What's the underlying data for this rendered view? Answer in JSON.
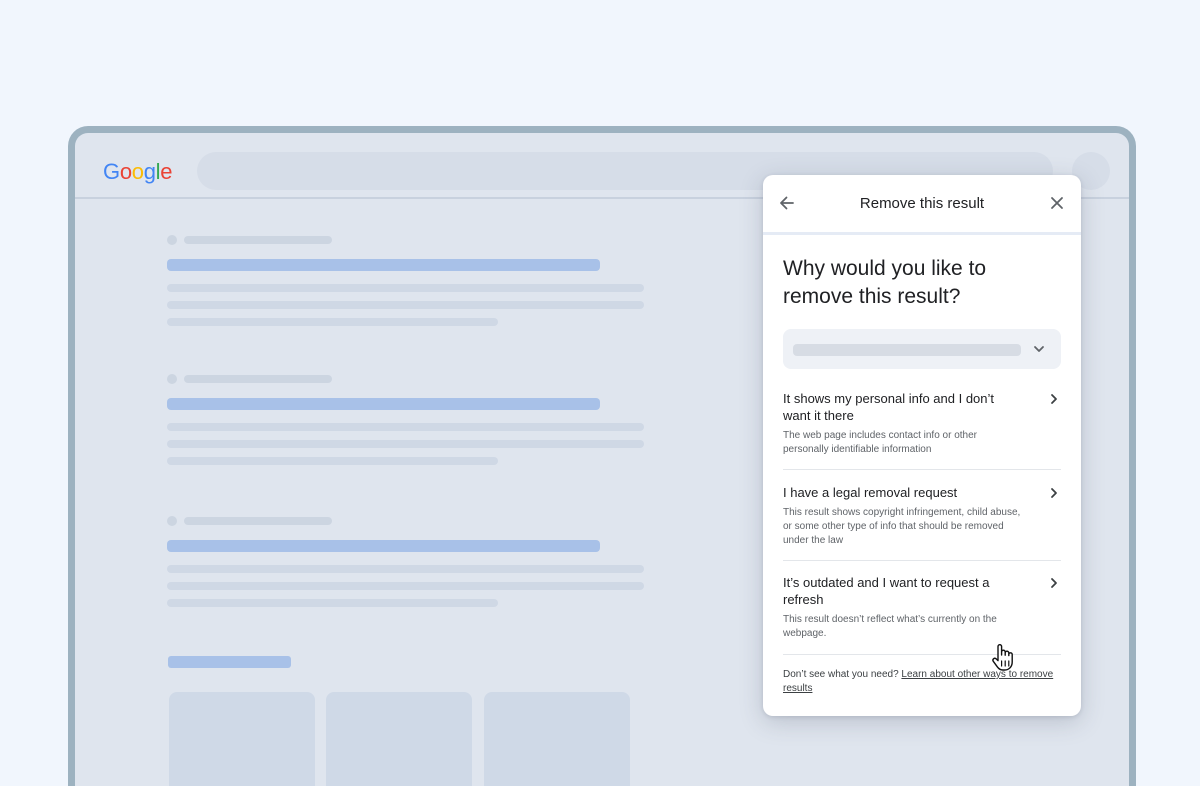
{
  "logo": {
    "letters": [
      "G",
      "o",
      "o",
      "g",
      "l",
      "e"
    ],
    "colors": [
      "#4285F4",
      "#EA4335",
      "#FBBC05",
      "#4285F4",
      "#34A853",
      "#EA4335"
    ]
  },
  "modal": {
    "title": "Remove this result",
    "question": "Why would you like to remove this result?",
    "options": [
      {
        "title": "It shows my personal info and I don’t want it there",
        "description": "The web page includes contact info or other personally identifiable information"
      },
      {
        "title": "I have a legal removal request",
        "description": "This result shows copyright infringement, child abuse, or some other type of info that should be removed under the law"
      },
      {
        "title": "It’s outdated and I want to request a refresh",
        "description": "This result doesn’t reflect what’s currently on the webpage."
      }
    ],
    "footer_text": "Don’t see what you need? ",
    "footer_link": "Learn about other ways to remove results"
  },
  "icons": {
    "back": "arrow-left-icon",
    "close": "close-icon",
    "dropdown": "chevron-down-icon",
    "option": "chevron-right-icon",
    "cursor": "hand-pointer-icon"
  }
}
